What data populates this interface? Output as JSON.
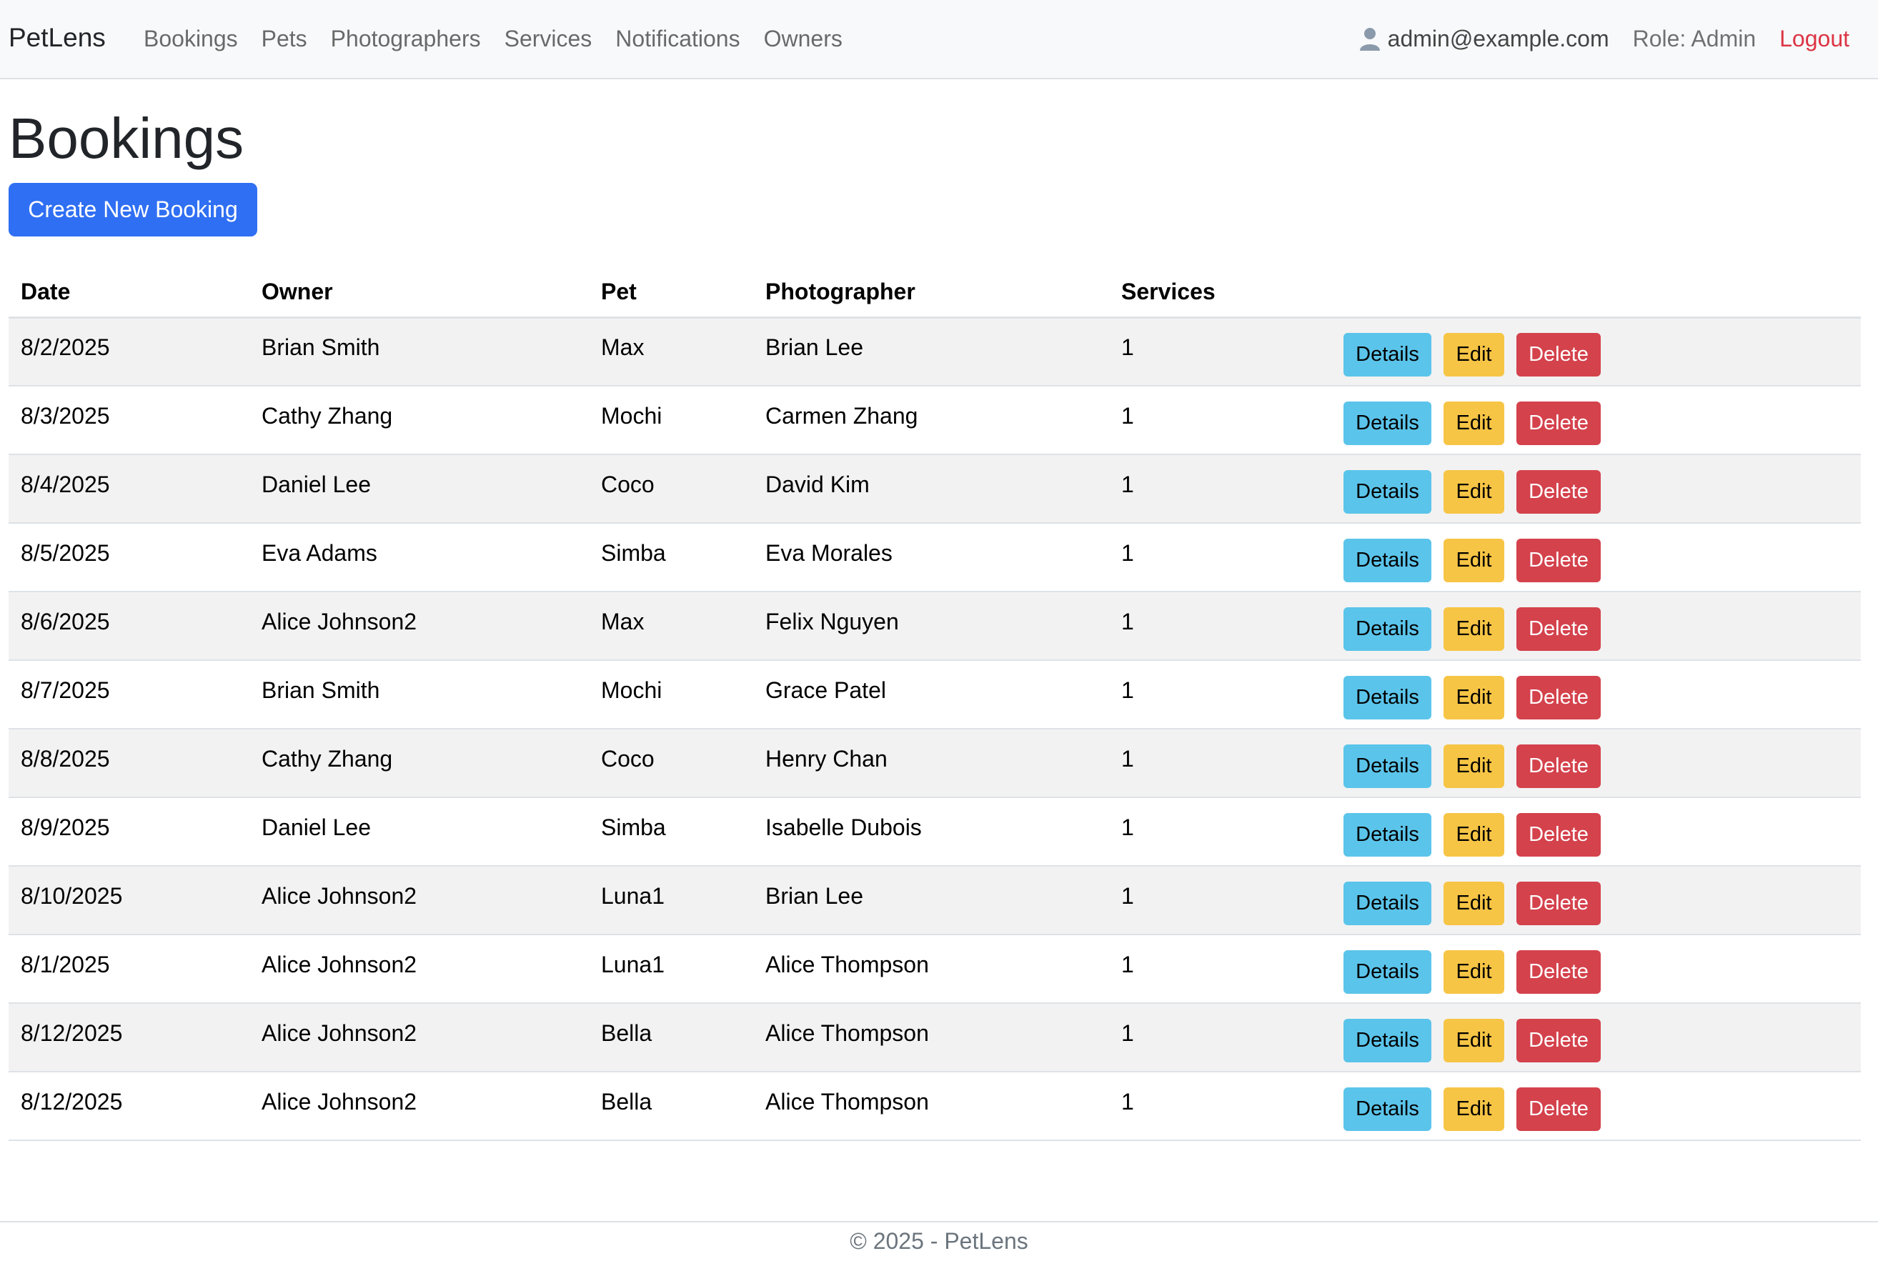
{
  "navbar": {
    "brand": "PetLens",
    "links": [
      "Bookings",
      "Pets",
      "Photographers",
      "Services",
      "Notifications",
      "Owners"
    ],
    "user_email": "admin@example.com",
    "role": "Role: Admin",
    "logout": "Logout"
  },
  "page": {
    "title": "Bookings",
    "create_button": "Create New Booking"
  },
  "table": {
    "headers": [
      "Date",
      "Owner",
      "Pet",
      "Photographer",
      "Services",
      ""
    ],
    "actions": {
      "details": "Details",
      "edit": "Edit",
      "delete": "Delete"
    },
    "rows": [
      {
        "date": "8/2/2025",
        "owner": "Brian Smith",
        "pet": "Max",
        "photographer": "Brian Lee",
        "services": "1"
      },
      {
        "date": "8/3/2025",
        "owner": "Cathy Zhang",
        "pet": "Mochi",
        "photographer": "Carmen Zhang",
        "services": "1"
      },
      {
        "date": "8/4/2025",
        "owner": "Daniel Lee",
        "pet": "Coco",
        "photographer": "David Kim",
        "services": "1"
      },
      {
        "date": "8/5/2025",
        "owner": "Eva Adams",
        "pet": "Simba",
        "photographer": "Eva Morales",
        "services": "1"
      },
      {
        "date": "8/6/2025",
        "owner": "Alice Johnson2",
        "pet": "Max",
        "photographer": "Felix Nguyen",
        "services": "1"
      },
      {
        "date": "8/7/2025",
        "owner": "Brian Smith",
        "pet": "Mochi",
        "photographer": "Grace Patel",
        "services": "1"
      },
      {
        "date": "8/8/2025",
        "owner": "Cathy Zhang",
        "pet": "Coco",
        "photographer": "Henry Chan",
        "services": "1"
      },
      {
        "date": "8/9/2025",
        "owner": "Daniel Lee",
        "pet": "Simba",
        "photographer": "Isabelle Dubois",
        "services": "1"
      },
      {
        "date": "8/10/2025",
        "owner": "Alice Johnson2",
        "pet": "Luna1",
        "photographer": "Brian Lee",
        "services": "1"
      },
      {
        "date": "8/1/2025",
        "owner": "Alice Johnson2",
        "pet": "Luna1",
        "photographer": "Alice Thompson",
        "services": "1"
      },
      {
        "date": "8/12/2025",
        "owner": "Alice Johnson2",
        "pet": "Bella",
        "photographer": "Alice Thompson",
        "services": "1"
      },
      {
        "date": "8/12/2025",
        "owner": "Alice Johnson2",
        "pet": "Bella",
        "photographer": "Alice Thompson",
        "services": "1"
      }
    ]
  },
  "footer": {
    "text": "© 2025 - PetLens"
  },
  "colors": {
    "primary": "#2f6ff3",
    "info": "#5bc4ea",
    "warning": "#f7c545",
    "danger": "#d4424c",
    "logout": "#dc3545"
  },
  "icons": {
    "user": "person-icon"
  }
}
